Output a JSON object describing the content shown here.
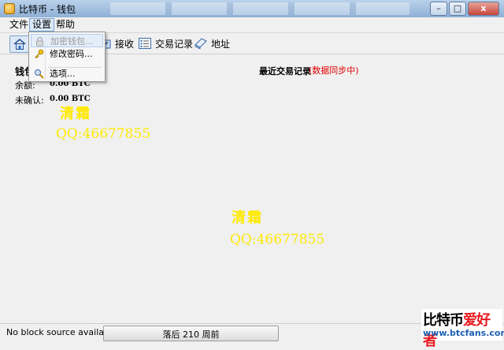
{
  "window": {
    "title": "比特币 - 钱包",
    "buttons": {
      "minimize": "–",
      "maximize": "□",
      "close": "x"
    }
  },
  "menubar": {
    "items": [
      "文件",
      "设置",
      "帮助"
    ],
    "active_index": 1
  },
  "toolbar": {
    "items": [
      {
        "label": "",
        "icon": "home-icon"
      },
      {
        "label": "接收",
        "icon": "receive-icon"
      },
      {
        "label": "交易记录",
        "icon": "transactions-icon"
      },
      {
        "label": "地址",
        "icon": "address-book-icon"
      }
    ]
  },
  "settings_menu": {
    "items": [
      {
        "label": "加密钱包...",
        "icon": "lock-icon",
        "enabled": false
      },
      {
        "label": "修改密码...",
        "icon": "key-icon",
        "enabled": true
      },
      {
        "label": "选项...",
        "icon": "options-icon",
        "enabled": true
      }
    ]
  },
  "wallet": {
    "title": "钱包",
    "balance_label": "余额:",
    "balance_value": "0.00 BTC",
    "unconfirmed_label": "未确认:",
    "unconfirmed_value": "0.00 BTC"
  },
  "recent": {
    "title": "最近交易记录",
    "sync_note": "(数据同步中)"
  },
  "watermarks": [
    {
      "name": "清霜",
      "qq": "QQ:46677855"
    },
    {
      "name": "清霜",
      "qq": "QQ:46677855"
    }
  ],
  "status": {
    "message": "No block source available...",
    "progress_text": "落后 210 周前",
    "progress": 0.0
  },
  "site_logo": {
    "part1": "比特币",
    "part2": "爱好者",
    "url": "www.btcfans.com"
  },
  "colors": {
    "watermark": "#ffe900",
    "sync_note": "#e00000",
    "title_bar": "#b9d1ea"
  }
}
